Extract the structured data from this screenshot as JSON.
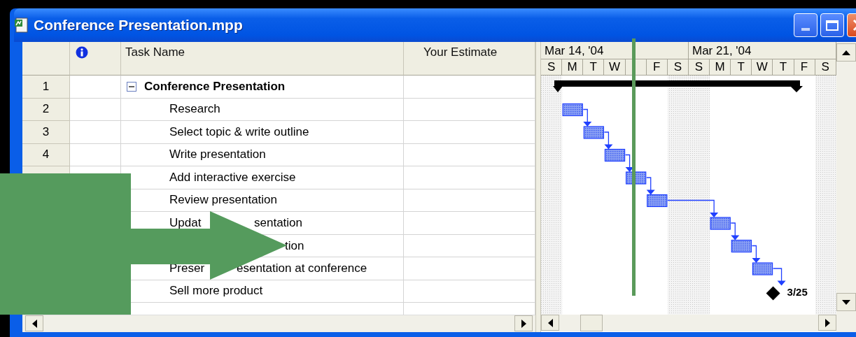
{
  "window": {
    "title": "Conference Presentation.mpp"
  },
  "columns": {
    "task_name": "Task Name",
    "estimate": "Your Estimate"
  },
  "timescale": {
    "weeks": [
      "Mar 14, '04",
      "Mar 21, '04"
    ],
    "days": [
      "S",
      "M",
      "T",
      "W",
      "F",
      "S",
      "S",
      "M",
      "T",
      "W",
      "T",
      "F",
      "S"
    ]
  },
  "tasks": [
    {
      "id": "1",
      "name": "Conference Presentation",
      "kind": "summary",
      "expanded": true
    },
    {
      "id": "2",
      "name": "Research",
      "kind": "task"
    },
    {
      "id": "3",
      "name": "Select topic & write outline",
      "kind": "task"
    },
    {
      "id": "4",
      "name": "Write presentation",
      "kind": "task"
    },
    {
      "name": "Add interactive exercise",
      "kind": "task"
    },
    {
      "name": "Review presentation",
      "kind": "task"
    },
    {
      "name_parts": [
        "Updat",
        "sentation"
      ],
      "kind": "task"
    },
    {
      "name_parts": [
        "tion"
      ],
      "kind": "task"
    },
    {
      "name_parts": [
        "Preser",
        "esentation at conference"
      ],
      "kind": "task"
    },
    {
      "name": "Sell more product",
      "kind": "milestone",
      "bar_label": "3/25"
    }
  ]
}
